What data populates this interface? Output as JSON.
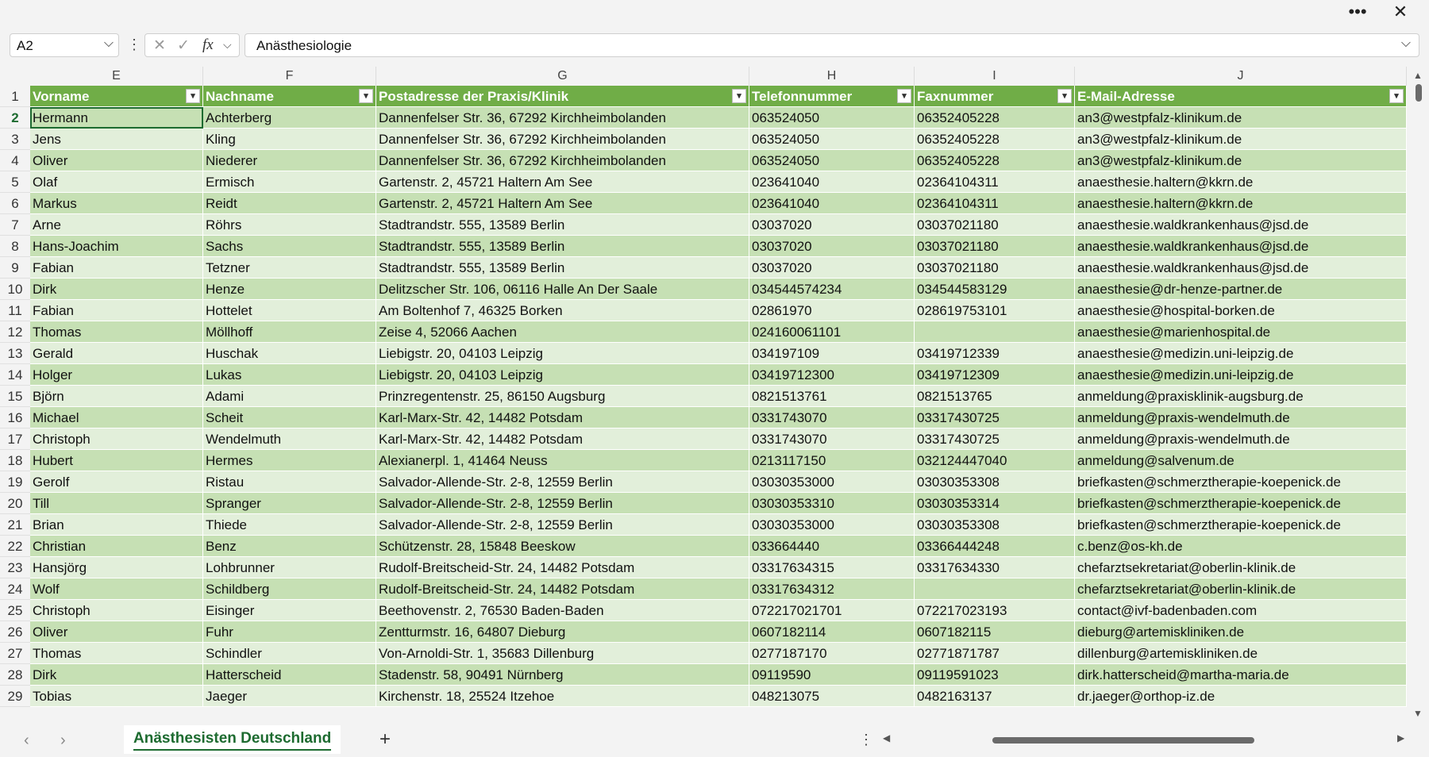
{
  "window": {
    "more_label": "•••",
    "close_label": "✕"
  },
  "formula_bar": {
    "name_box": "A2",
    "cancel_label": "✕",
    "enter_label": "✓",
    "fx_label": "fx",
    "formula": "Anästhesiologie"
  },
  "columns": [
    "E",
    "F",
    "G",
    "H",
    "I",
    "J"
  ],
  "headers": [
    "Vorname",
    "Nachname",
    "Postadresse der Praxis/Klinik",
    "Telefonnummer",
    "Faxnummer",
    "E-Mail-Adresse"
  ],
  "rows": [
    [
      "Hermann",
      "Achterberg",
      "Dannenfelser Str. 36, 67292 Kirchheimbolanden",
      "063524050",
      "06352405228",
      "an3@westpfalz-klinikum.de"
    ],
    [
      "Jens",
      "Kling",
      "Dannenfelser Str. 36, 67292 Kirchheimbolanden",
      "063524050",
      "06352405228",
      "an3@westpfalz-klinikum.de"
    ],
    [
      "Oliver",
      "Niederer",
      "Dannenfelser Str. 36, 67292 Kirchheimbolanden",
      "063524050",
      "06352405228",
      "an3@westpfalz-klinikum.de"
    ],
    [
      "Olaf",
      "Ermisch",
      "Gartenstr. 2, 45721 Haltern Am See",
      "023641040",
      "02364104311",
      "anaesthesie.haltern@kkrn.de"
    ],
    [
      "Markus",
      "Reidt",
      "Gartenstr. 2, 45721 Haltern Am See",
      "023641040",
      "02364104311",
      "anaesthesie.haltern@kkrn.de"
    ],
    [
      "Arne",
      "Röhrs",
      "Stadtrandstr. 555, 13589 Berlin",
      "03037020",
      "03037021180",
      "anaesthesie.waldkrankenhaus@jsd.de"
    ],
    [
      "Hans-Joachim",
      "Sachs",
      "Stadtrandstr. 555, 13589 Berlin",
      "03037020",
      "03037021180",
      "anaesthesie.waldkrankenhaus@jsd.de"
    ],
    [
      "Fabian",
      "Tetzner",
      "Stadtrandstr. 555, 13589 Berlin",
      "03037020",
      "03037021180",
      "anaesthesie.waldkrankenhaus@jsd.de"
    ],
    [
      "Dirk",
      "Henze",
      "Delitzscher Str. 106, 06116 Halle An Der Saale",
      "034544574234",
      "034544583129",
      "anaesthesie@dr-henze-partner.de"
    ],
    [
      "Fabian",
      "Hottelet",
      "Am Boltenhof 7, 46325 Borken",
      "02861970",
      "028619753101",
      "anaesthesie@hospital-borken.de"
    ],
    [
      "Thomas",
      "Möllhoff",
      "Zeise 4, 52066 Aachen",
      "024160061101",
      "",
      "anaesthesie@marienhospital.de"
    ],
    [
      "Gerald",
      "Huschak",
      "Liebigstr. 20, 04103 Leipzig",
      "034197109",
      "03419712339",
      "anaesthesie@medizin.uni-leipzig.de"
    ],
    [
      "Holger",
      "Lukas",
      "Liebigstr. 20, 04103 Leipzig",
      "03419712300",
      "03419712309",
      "anaesthesie@medizin.uni-leipzig.de"
    ],
    [
      "Björn",
      "Adami",
      "Prinzregentenstr. 25, 86150 Augsburg",
      "0821513761",
      "0821513765",
      "anmeldung@praxisklinik-augsburg.de"
    ],
    [
      "Michael",
      "Scheit",
      "Karl-Marx-Str. 42, 14482 Potsdam",
      "0331743070",
      "03317430725",
      "anmeldung@praxis-wendelmuth.de"
    ],
    [
      "Christoph",
      "Wendelmuth",
      "Karl-Marx-Str. 42, 14482 Potsdam",
      "0331743070",
      "03317430725",
      "anmeldung@praxis-wendelmuth.de"
    ],
    [
      "Hubert",
      "Hermes",
      "Alexianerpl. 1, 41464 Neuss",
      "0213117150",
      "032124447040",
      "anmeldung@salvenum.de"
    ],
    [
      "Gerolf",
      "Ristau",
      "Salvador-Allende-Str. 2-8, 12559 Berlin",
      "03030353000",
      "03030353308",
      "briefkasten@schmerztherapie-koepenick.de"
    ],
    [
      "Till",
      "Spranger",
      "Salvador-Allende-Str. 2-8, 12559 Berlin",
      "03030353310",
      "03030353314",
      "briefkasten@schmerztherapie-koepenick.de"
    ],
    [
      "Brian",
      "Thiede",
      "Salvador-Allende-Str. 2-8, 12559 Berlin",
      "03030353000",
      "03030353308",
      "briefkasten@schmerztherapie-koepenick.de"
    ],
    [
      "Christian",
      "Benz",
      "Schützenstr. 28, 15848 Beeskow",
      "033664440",
      "03366444248",
      "c.benz@os-kh.de"
    ],
    [
      "Hansjörg",
      "Lohbrunner",
      "Rudolf-Breitscheid-Str. 24, 14482 Potsdam",
      "03317634315",
      "03317634330",
      "chefarztsekretariat@oberlin-klinik.de"
    ],
    [
      "Wolf",
      "Schildberg",
      "Rudolf-Breitscheid-Str. 24, 14482 Potsdam",
      "03317634312",
      "",
      "chefarztsekretariat@oberlin-klinik.de"
    ],
    [
      "Christoph",
      "Eisinger",
      "Beethovenstr. 2, 76530 Baden-Baden",
      "072217021701",
      "072217023193",
      "contact@ivf-badenbaden.com"
    ],
    [
      "Oliver",
      "Fuhr",
      "Zentturmstr. 16, 64807 Dieburg",
      "0607182114",
      "0607182115",
      "dieburg@artemiskliniken.de"
    ],
    [
      "Thomas",
      "Schindler",
      "Von-Arnoldi-Str. 1, 35683 Dillenburg",
      "0277187170",
      "02771871787",
      "dillenburg@artemiskliniken.de"
    ],
    [
      "Dirk",
      "Hatterscheid",
      "Stadenstr. 58, 90491 Nürnberg",
      "09119590",
      "09119591023",
      "dirk.hatterscheid@martha-maria.de"
    ],
    [
      "Tobias",
      "Jaeger",
      "Kirchenstr. 18, 25524 Itzehoe",
      "048213075",
      "0482163137",
      "dr.jaeger@orthop-iz.de"
    ]
  ],
  "sheet_tabs": [
    {
      "label": "Anästhesisten Deutschland",
      "active": true
    }
  ],
  "add_sheet_label": "+",
  "colors": {
    "header_green": "#70ad47",
    "band_dark": "#c6e0b4",
    "band_light": "#e2efda",
    "accent": "#1d6b30"
  }
}
